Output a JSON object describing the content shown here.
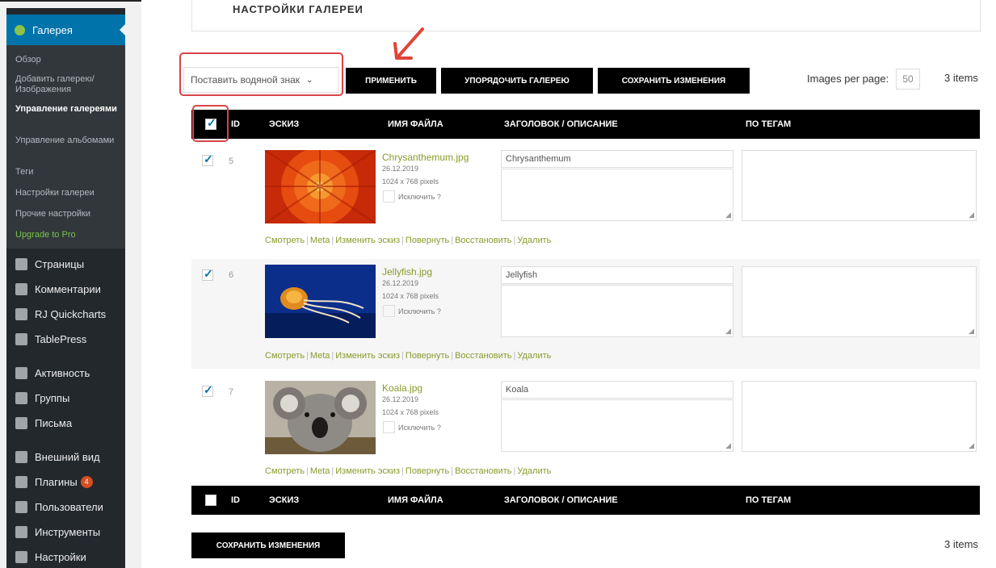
{
  "sidebar": {
    "header": "Галерея",
    "submenu": [
      "Обзор",
      "Добавить галерею/ Изображения",
      "Управление галереями",
      "Управление альбомами",
      "Теги",
      "Настройки галереи",
      "Прочие настройки",
      "Upgrade to Pro"
    ],
    "menu": [
      "Страницы",
      "Комментарии",
      "RJ Quickcharts",
      "TablePress",
      "Активность",
      "Группы",
      "Письма",
      "Внешний вид",
      "Плагины",
      "Пользователи",
      "Инструменты",
      "Настройки"
    ],
    "plugins_badge": "4"
  },
  "settings_header": "НАСТРОЙКИ ГАЛЕРЕИ",
  "toolbar": {
    "select_value": "Поставить водяной знак",
    "apply": "ПРИМЕНИТЬ",
    "sort": "УПОРЯДОЧИТЬ ГАЛЕРЕЮ",
    "save": "СОХРАНИТЬ ИЗМЕНЕНИЯ",
    "per_page_label": "Images per page:",
    "per_page_value": "50",
    "items_count": "3 items"
  },
  "table": {
    "columns": [
      "ID",
      "ЭСКИЗ",
      "ИМЯ ФАЙЛА",
      "ЗАГОЛОВОК / ОПИСАНИЕ",
      "ПО ТЕГАМ"
    ],
    "rows": [
      {
        "id": "5",
        "file": "Chrysanthemum.jpg",
        "date": "26.12.2019",
        "size": "1024 x 768 pixels",
        "exclude": "Исключить ?",
        "title": "Chrysanthemum"
      },
      {
        "id": "6",
        "file": "Jellyfish.jpg",
        "date": "26.12.2019",
        "size": "1024 x 768 pixels",
        "exclude": "Исключить ?",
        "title": "Jellyfish"
      },
      {
        "id": "7",
        "file": "Koala.jpg",
        "date": "26.12.2019",
        "size": "1024 x 768 pixels",
        "exclude": "Исключить ?",
        "title": "Koala"
      }
    ],
    "actions": [
      "Смотреть",
      "Meta",
      "Изменить эскиз",
      "Повернуть",
      "Восстановить",
      "Удалить"
    ]
  },
  "footer": {
    "save": "СОХРАНИТЬ ИЗМЕНЕНИЯ",
    "items_count": "3 items"
  },
  "colors": {
    "accent": "#0073aa",
    "link": "#8a9a2a",
    "highlight": "#d9434a"
  }
}
